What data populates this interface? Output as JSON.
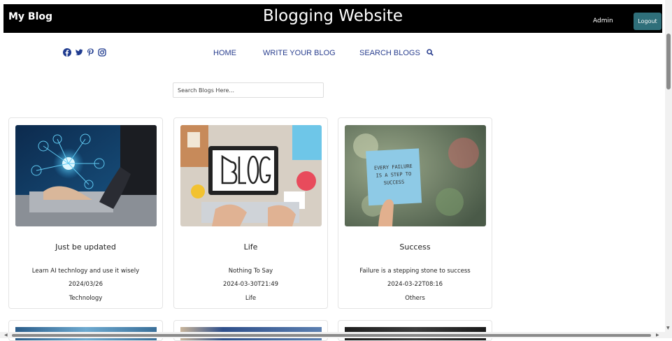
{
  "header": {
    "brand": "My Blog",
    "title": "Blogging Website",
    "user": "Admin",
    "logout_label": "Logout"
  },
  "social": [
    "facebook-icon",
    "twitter-icon",
    "pinterest-icon",
    "instagram-icon"
  ],
  "nav": {
    "home": "HOME",
    "write": "WRITE YOUR BLOG",
    "search": "SEARCH BLOGS"
  },
  "search": {
    "placeholder": "Search Blogs Here..."
  },
  "cards": [
    {
      "title": "Just be updated",
      "description": "Learn AI technlogy and use it wisely",
      "date": "2024/03/26",
      "category": "Technology",
      "image": "ai-laptop-image"
    },
    {
      "title": "Life",
      "description": "Nothing To Say",
      "date": "2024-03-30T21:49",
      "category": "Life",
      "image": "blog-desk-image"
    },
    {
      "title": "Success",
      "description": "Failure is a stepping stone to success",
      "date": "2024-03-22T08:16",
      "category": "Others",
      "image": "success-note-image",
      "image_text": [
        "EVERY FAILURE",
        "IS A STEP TO",
        "SUCCESS"
      ]
    }
  ],
  "colors": {
    "topbar": "#000000",
    "logout": "#2f6f7a",
    "nav": "#2a3f8f"
  }
}
